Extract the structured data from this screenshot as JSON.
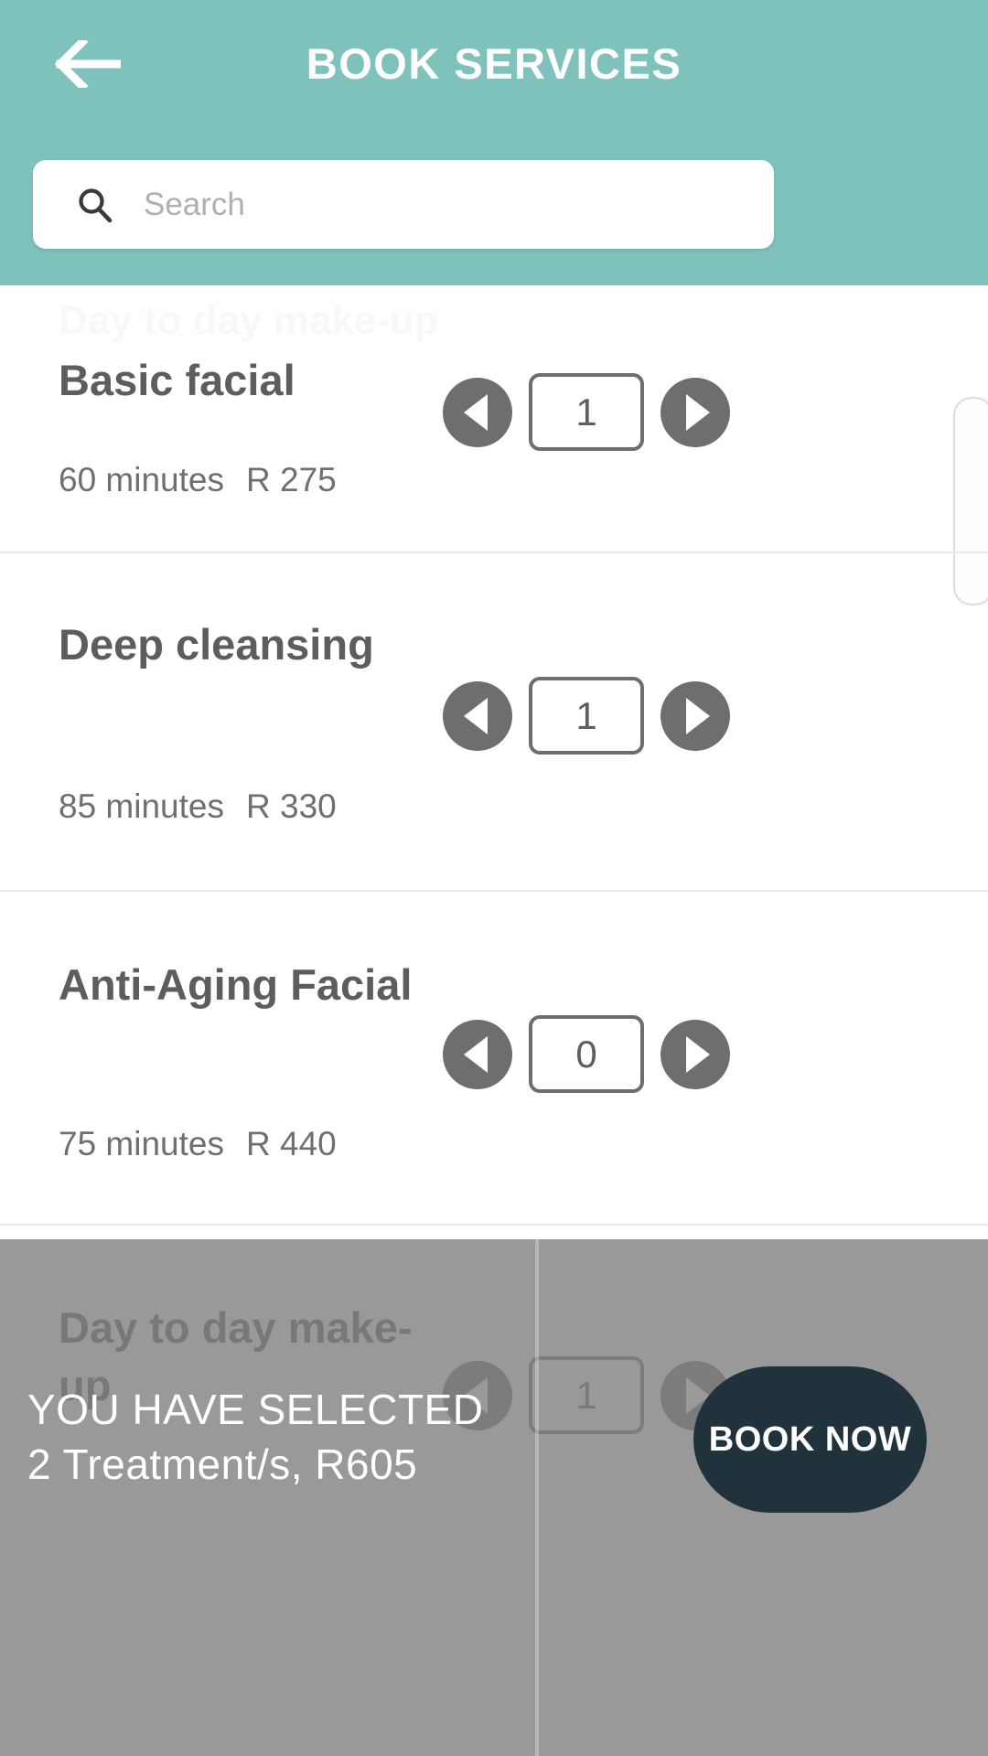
{
  "header": {
    "title": "BOOK SERVICES",
    "back_icon": "arrow-left-icon",
    "background_color": "#7FC2BC"
  },
  "search": {
    "icon": "search-icon",
    "placeholder": "Search",
    "value": ""
  },
  "list": {
    "ghost_row_label": "Day to day make-up",
    "services": [
      {
        "name": "Basic facial",
        "duration": "60 minutes",
        "price": "R 275",
        "quantity": "1",
        "decrement_icon": "triangle-left-icon",
        "increment_icon": "triangle-right-icon"
      },
      {
        "name": "Deep cleansing",
        "duration": "85 minutes",
        "price": "R 330",
        "quantity": "1",
        "decrement_icon": "triangle-left-icon",
        "increment_icon": "triangle-right-icon"
      },
      {
        "name": "Anti-Aging Facial",
        "duration": "75 minutes",
        "price": "R 440",
        "quantity": "0",
        "decrement_icon": "triangle-left-icon",
        "increment_icon": "triangle-right-icon"
      }
    ],
    "partial_next_service": {
      "name": "Day to day make-up",
      "quantity": "1"
    }
  },
  "bottom_bar": {
    "selected_label": "YOU HAVE SELECTED",
    "selected_summary": "2 Treatment/s, R605",
    "book_button_label": "BOOK NOW",
    "book_button_color": "#20323C",
    "bar_color": "#7F7F7F"
  }
}
